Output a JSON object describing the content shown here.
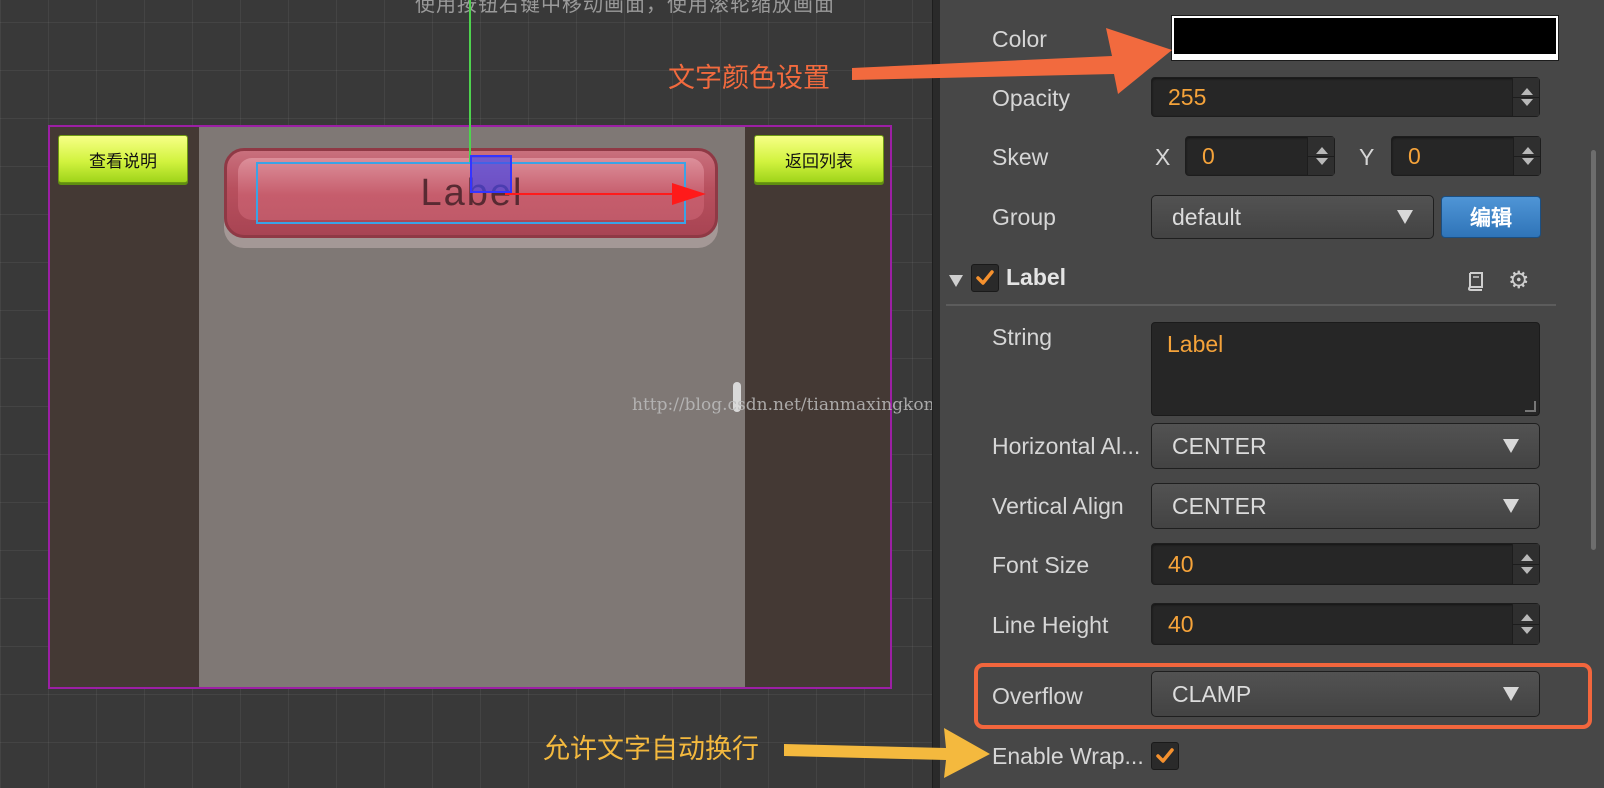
{
  "scene": {
    "hint_text": "使用按钮右键中移动画面，使用滚轮缩放画面",
    "buttons": {
      "help": "查看说明",
      "back": "返回列表"
    },
    "label_text": "Label",
    "watermark": "http://blog.csdn.net/tianmaxingkong_"
  },
  "inspector": {
    "color": {
      "label": "Color",
      "value": "#000000"
    },
    "opacity": {
      "label": "Opacity",
      "value": "255"
    },
    "skew": {
      "label": "Skew",
      "x_label": "X",
      "x_value": "0",
      "y_label": "Y",
      "y_value": "0"
    },
    "group": {
      "label": "Group",
      "value": "default",
      "edit_label": "编辑"
    },
    "label_component": {
      "title": "Label",
      "enabled": true
    },
    "string": {
      "label": "String",
      "value": "Label"
    },
    "horizontal_align": {
      "label": "Horizontal Al...",
      "value": "CENTER"
    },
    "vertical_align": {
      "label": "Vertical Align",
      "value": "CENTER"
    },
    "font_size": {
      "label": "Font Size",
      "value": "40"
    },
    "line_height": {
      "label": "Line Height",
      "value": "40"
    },
    "overflow": {
      "label": "Overflow",
      "value": "CLAMP"
    },
    "enable_wrap": {
      "label": "Enable Wrap...",
      "checked": true
    }
  },
  "annotations": {
    "color_note": "文字颜色设置",
    "wrap_note": "允许文字自动换行",
    "color_note_color": "#f26a3e",
    "wrap_note_color": "#f4b93e"
  }
}
